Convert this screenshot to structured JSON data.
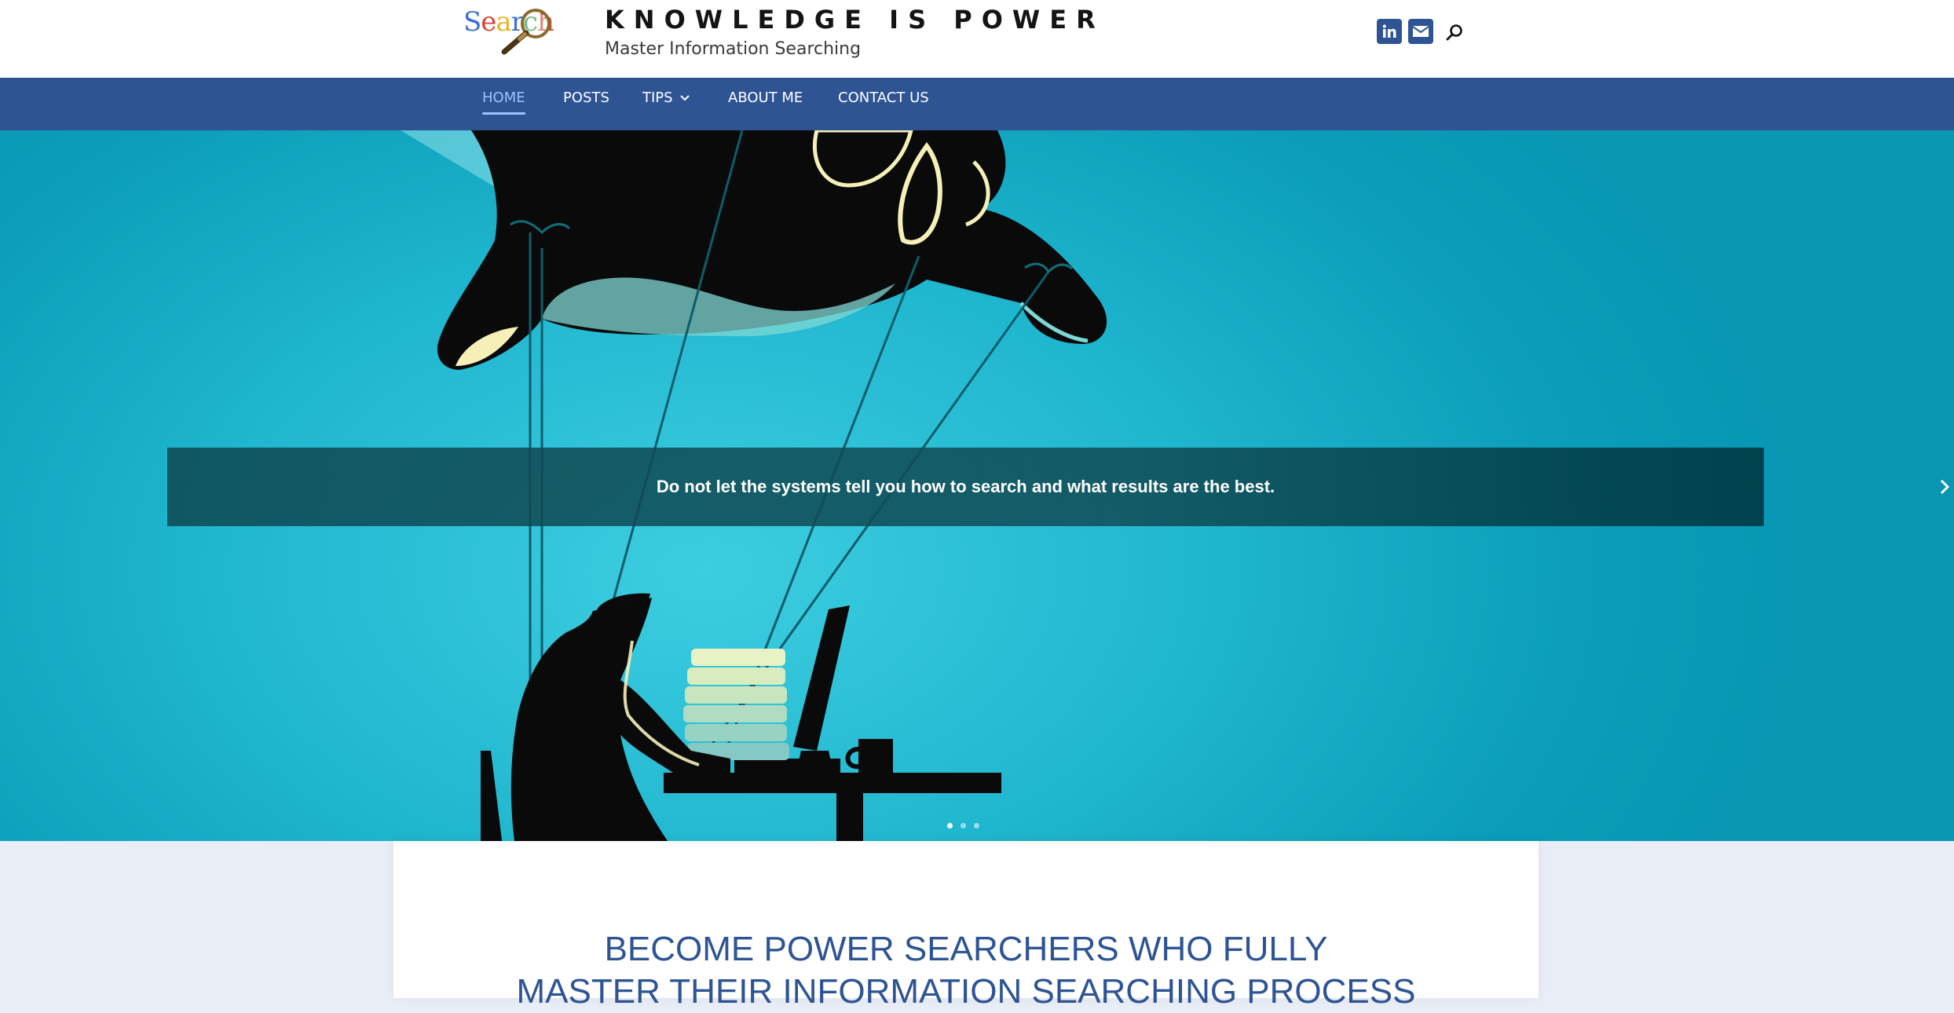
{
  "header": {
    "logo_text": "Search",
    "site_title": "KNOWLEDGE IS POWER",
    "tagline": "Master Information Searching",
    "social": [
      {
        "name": "linkedin-icon",
        "label": "in"
      },
      {
        "name": "mail-icon",
        "label": ""
      }
    ],
    "search_icon": "search-icon"
  },
  "nav": {
    "items": [
      {
        "label": "HOME",
        "active": true
      },
      {
        "label": "POSTS",
        "active": false
      },
      {
        "label": "TIPS",
        "active": false,
        "has_dropdown": true
      },
      {
        "label": "ABOUT ME",
        "active": false
      },
      {
        "label": "CONTACT US",
        "active": false
      }
    ]
  },
  "hero": {
    "caption": "Do not let the systems tell you how to search and what results are the best.",
    "next_icon": "chevron-right-icon",
    "slides": 3,
    "active_slide": 1
  },
  "intro": {
    "heading_line1": "BECOME POWER SEARCHERS WHO FULLY",
    "heading_line2": "MASTER THEIR INFORMATION SEARCHING PROCESS"
  },
  "colors": {
    "brand_blue": "#2e5494",
    "nav_active": "#9cc2ff",
    "hero_teal": "#1fb6cf",
    "page_bg": "#e9edf6"
  }
}
